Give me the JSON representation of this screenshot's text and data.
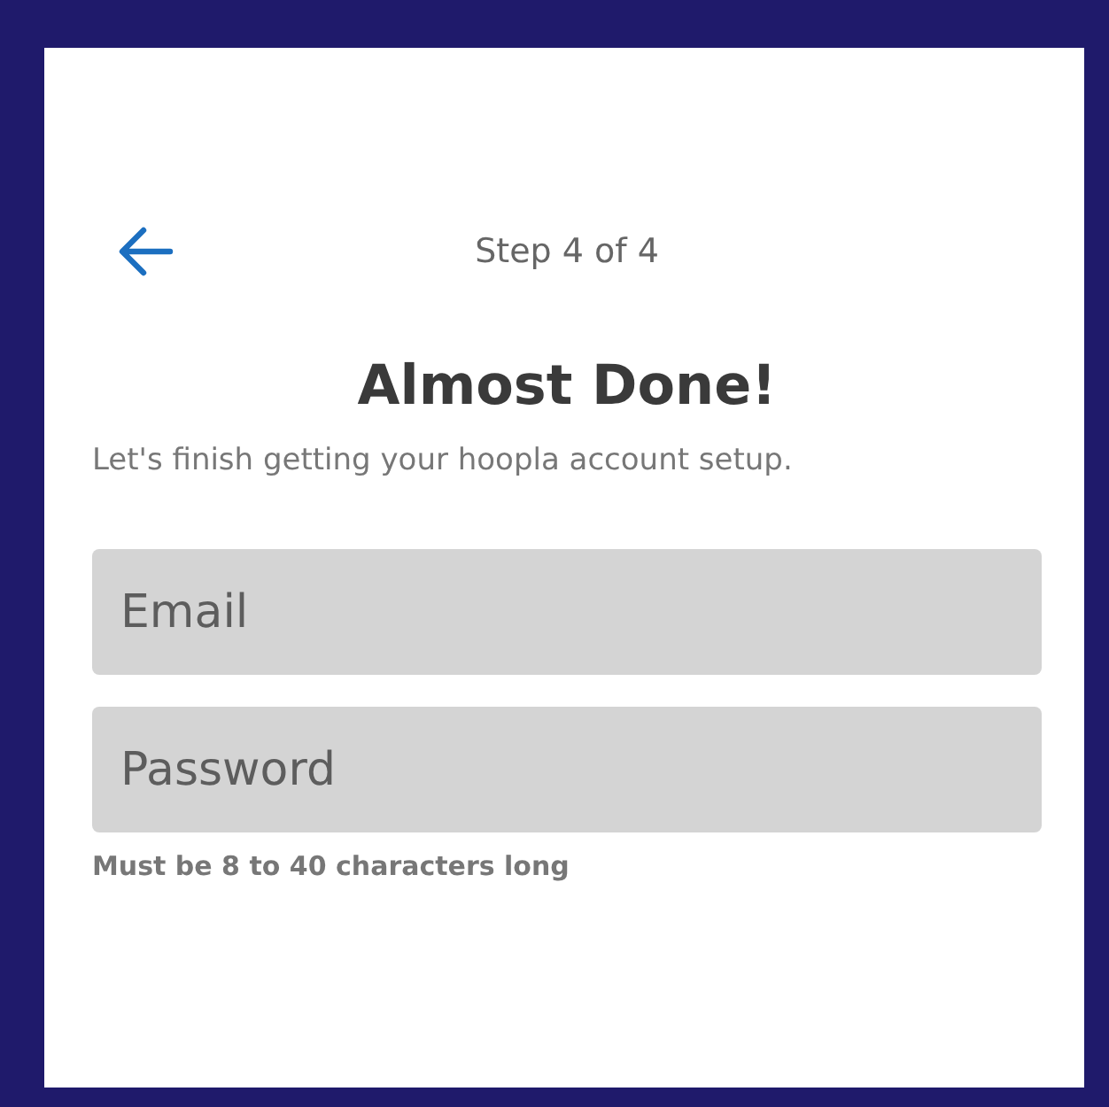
{
  "header": {
    "step": "Step 4 of 4"
  },
  "title": "Almost Done!",
  "subtitle": "Let's finish getting your hoopla account setup.",
  "fields": [
    {
      "placeholder": "Email"
    },
    {
      "placeholder": "Password"
    }
  ],
  "hint": "Must be 8 to 40 characters long"
}
